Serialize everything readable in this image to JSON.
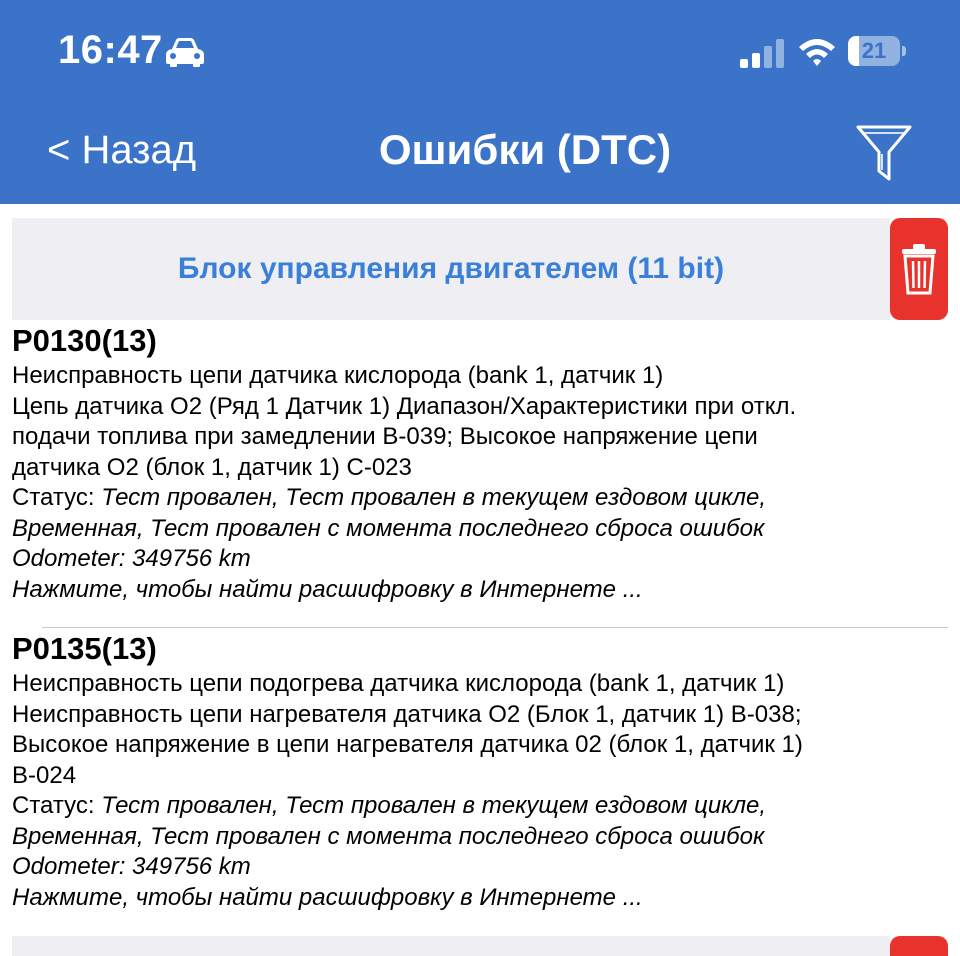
{
  "status_bar": {
    "time": "16:47",
    "battery_level": "21",
    "icons": [
      "car-icon",
      "signal-icon",
      "wifi-icon",
      "battery-icon"
    ]
  },
  "nav": {
    "back_label": "< Назад",
    "title": "Ошибки (DTC)",
    "filter_icon": "filter-icon"
  },
  "colors": {
    "header_bg": "#3a73c8",
    "section_title": "#3a80d9",
    "delete_bg": "#e8332c",
    "section_bg": "#efeff3"
  },
  "section": {
    "title": "Блок управления двигателем (11 bit)",
    "delete_icon": "trash-icon"
  },
  "dtcs": [
    {
      "code": "P0130(13)",
      "description_lines": [
        "Неисправность цепи датчика кислорода (bank 1, датчик 1)",
        "Цепь датчика O2 (Ряд 1 Датчик 1) Диапазон/Характеристики при откл.",
        "подачи топлива при замедлении B-039; Высокое напряжение цепи",
        "датчика O2 (блок 1, датчик 1) C-023"
      ],
      "status_label": "Статус: ",
      "status_line1": "Тест провален, Тест провален в текущем ездовом цикле,",
      "status_line2": "Временная, Тест провален с момента последнего сброса ошибок",
      "odometer": "Odometer: 349756 km",
      "search_link": "Нажмите, чтобы найти расшифровку в Интернете ..."
    },
    {
      "code": "P0135(13)",
      "description_lines": [
        "Неисправность цепи подогрева датчика кислорода (bank 1, датчик 1)",
        "Неисправность цепи нагревателя датчика O2 (Блок 1, датчик 1) B-038;",
        "Высокое напряжение в цепи нагревателя датчика 02 (блок 1, датчик 1)",
        "B-024"
      ],
      "status_label": "Статус: ",
      "status_line1": "Тест провален, Тест провален в текущем ездовом цикле,",
      "status_line2": "Временная, Тест провален с момента последнего сброса ошибок",
      "odometer": "Odometer: 349756 km",
      "search_link": "Нажмите, чтобы найти расшифровку в Интернете ..."
    }
  ]
}
